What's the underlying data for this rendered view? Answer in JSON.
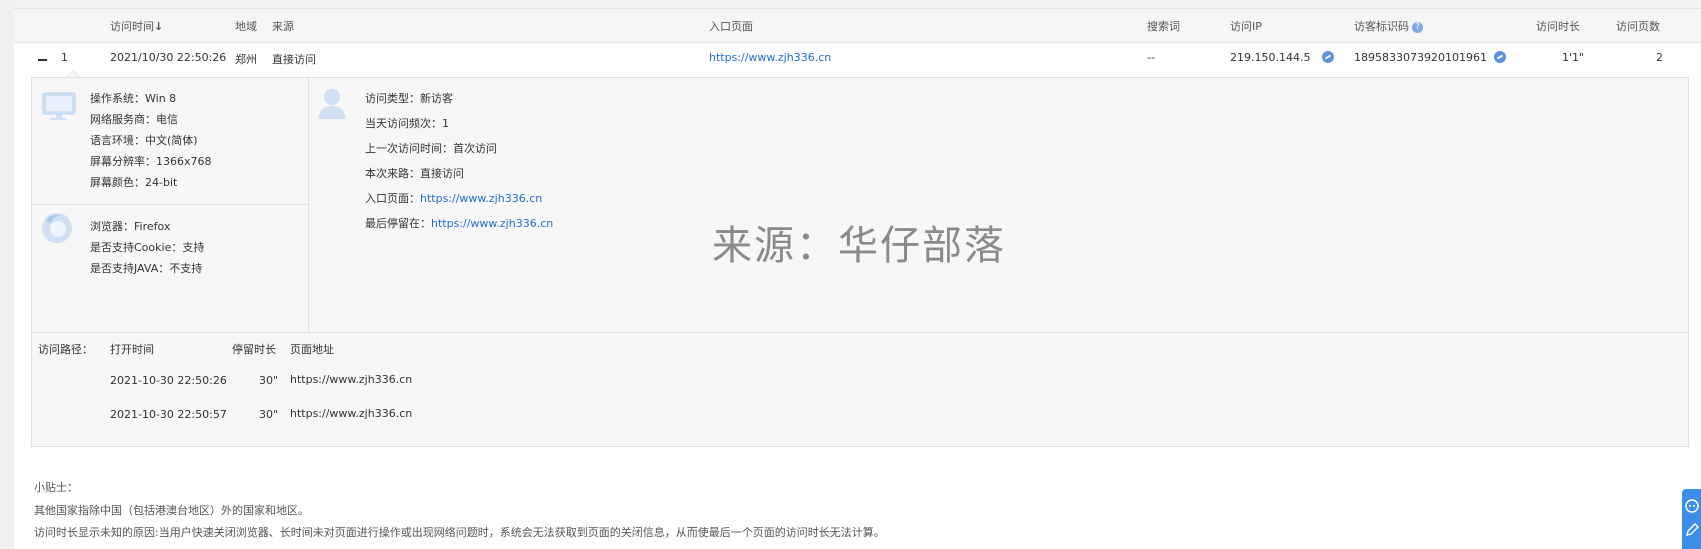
{
  "table_header": {
    "visit_time": "访问时间",
    "sort_icon": "↓",
    "region": "地域",
    "source": "来源",
    "entry_page": "入口页面",
    "search_term": "搜索词",
    "visit_ip": "访问IP",
    "visitor_id": "访客标识码",
    "help": "?",
    "duration": "访问时长",
    "page_count": "访问页数"
  },
  "row": {
    "index": "1",
    "visit_time": "2021/10/30 22:50:26",
    "region": "郑州",
    "source": "直接访问",
    "entry_page": "https://www.zjh336.cn",
    "search_term": "--",
    "ip": "219.150.144.5",
    "visitor_id": "1895833073920101961",
    "duration": "1'1\"",
    "page_count": "2"
  },
  "system_info": [
    {
      "label": "操作系统：",
      "value": "Win 8"
    },
    {
      "label": "网络服务商：",
      "value": "电信"
    },
    {
      "label": "语言环境：",
      "value": "中文(简体)"
    },
    {
      "label": "屏幕分辨率：",
      "value": "1366x768"
    },
    {
      "label": "屏幕颜色：",
      "value": "24-bit"
    }
  ],
  "browser_info": [
    {
      "label": "浏览器：",
      "value": "Firefox"
    },
    {
      "label": "是否支持Cookie：",
      "value": "支持"
    },
    {
      "label": "是否支持JAVA：",
      "value": "不支持"
    }
  ],
  "visit_info": [
    {
      "label": "访问类型：",
      "value": "新访客"
    },
    {
      "label": "当天访问频次：",
      "value": "1"
    },
    {
      "label": "上一次访问时间：",
      "value": "首次访问"
    },
    {
      "label": "本次来路：",
      "value": "直接访问"
    },
    {
      "label": "入口页面：",
      "value": "https://www.zjh336.cn"
    },
    {
      "label": "最后停留在：",
      "value": "https://www.zjh336.cn"
    }
  ],
  "watermark": "来源：华仔部落",
  "path": {
    "title": "访问路径：",
    "col_open_time": "打开时间",
    "col_stay": "停留时长",
    "col_url": "页面地址",
    "rows": [
      {
        "time": "2021-10-30 22:50:26",
        "stay": "30\"",
        "url": "https://www.zjh336.cn"
      },
      {
        "time": "2021-10-30 22:50:57",
        "stay": "30\"",
        "url": "https://www.zjh336.cn"
      }
    ]
  },
  "tips": {
    "title": "小贴士：",
    "line1": "其他国家指除中国（包括港澳台地区）外的国家和地区。",
    "line2": "访问时长显示未知的原因:当用户快速关闭浏览器、长时间未对页面进行操作或出现网络问题时，系统会无法获取到页面的关闭信息，从而使最后一个页面的访问时长无法计算。"
  },
  "colors": {
    "link": "#1f6fd1",
    "accent": "#3d8ee8",
    "icon_light": "#cfe0f5"
  }
}
